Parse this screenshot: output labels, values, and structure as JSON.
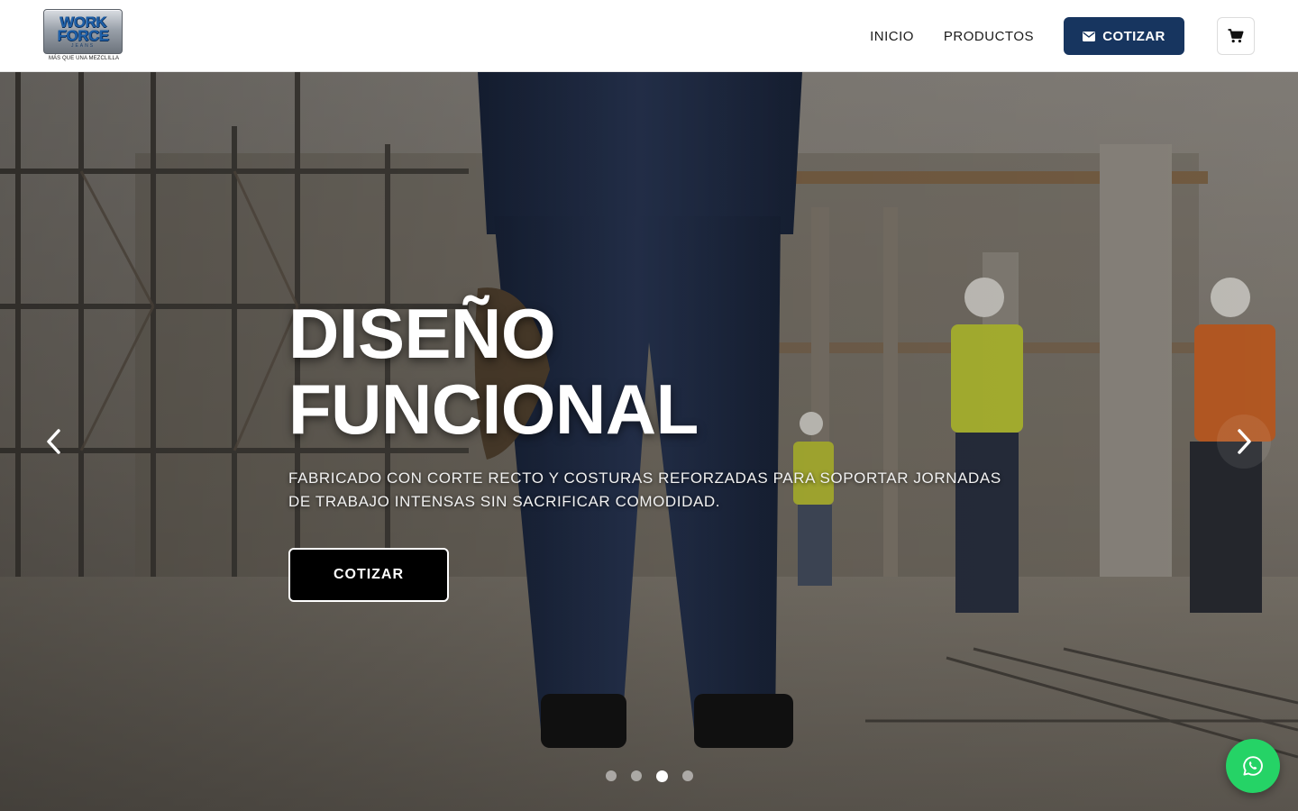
{
  "brand": {
    "logo_line1": "WORK",
    "logo_line2": "FORCE",
    "logo_sub": "JEANS",
    "tagline": "MÁS QUE UNA MEZCLILLA",
    "logo_color": "#1d5fa8"
  },
  "nav": {
    "items": [
      {
        "label": "INICIO"
      },
      {
        "label": "PRODUCTOS"
      }
    ],
    "cotizar_label": "COTIZAR",
    "cotizar_icon": "envelope-icon",
    "cart_icon": "shopping-cart-icon",
    "accent_color": "#17355f"
  },
  "hero": {
    "title_line1": "DISEÑO",
    "title_line2": "FUNCIONAL",
    "description": "FABRICADO CON CORTE RECTO Y COSTURAS REFORZADAS PARA SOPORTAR JORNADAS DE TRABAJO INTENSAS SIN SACRIFICAR COMODIDAD.",
    "cta_label": "COTIZAR",
    "prev_icon": "chevron-left-icon",
    "next_icon": "chevron-right-icon",
    "slides_total": 4,
    "active_slide": 3
  },
  "whatsapp": {
    "icon": "whatsapp-icon",
    "color": "#25d366"
  }
}
